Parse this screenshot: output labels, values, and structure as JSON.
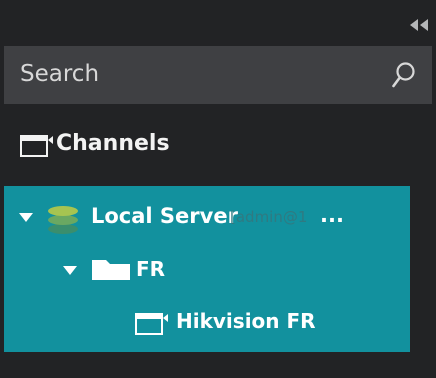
{
  "search": {
    "placeholder": "Search",
    "icon": "search-icon"
  },
  "top_controls": {
    "collapse_icon": "double-chevron-left-icon"
  },
  "channels": {
    "header_label": "Channels",
    "header_icon": "camera-monitor-icon"
  },
  "tree": {
    "selection_color": "#12919e",
    "server": {
      "label": "Local Server",
      "user_hint": "[admin@1",
      "ellipsis": "...",
      "icon": "server-stack-icon",
      "expanded": true
    },
    "folder": {
      "label": "FR",
      "icon": "folder-icon",
      "expanded": true
    },
    "camera": {
      "label": "Hikvision FR",
      "icon": "camera-monitor-icon"
    }
  }
}
